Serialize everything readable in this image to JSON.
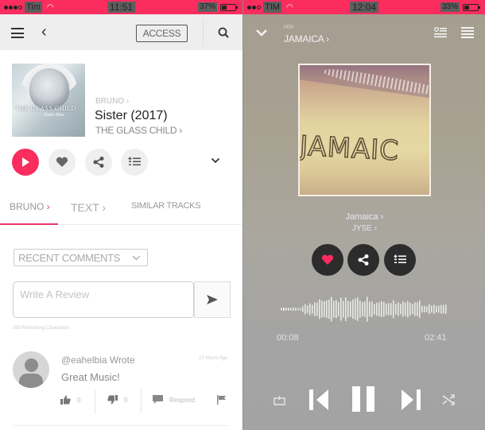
{
  "left_screen": {
    "status_bar": {
      "carrier": "Tim",
      "time": "11:51",
      "battery": "37%"
    },
    "header": {
      "access_label": "ACCESS"
    },
    "track": {
      "cover_text_1": "THE GLASS CHILD",
      "cover_text_2": "Sister Now",
      "artist": "BRUNO",
      "title": "Sister (2017)",
      "album": "THE GLASS CHILD"
    },
    "tabs": [
      {
        "label": "BRUNO",
        "active": true
      },
      {
        "label": "TEXT",
        "active": false
      },
      {
        "label": "SIMILAR TRACKS",
        "active": false
      }
    ],
    "sort_select": {
      "selected": "RECENT COMMENTS"
    },
    "review": {
      "placeholder": "Write A Review",
      "remaining": "250 Remaining Characters"
    },
    "comment": {
      "user": "@eahelbia Wrote",
      "time": "10 Hours Ago",
      "text": "Great Music!",
      "likes": "0",
      "dislikes": "0",
      "respond_label": "Respond"
    },
    "accent_color": "#fb2d5e"
  },
  "right_screen": {
    "status_bar": {
      "carrier": "TIM",
      "time": "12:04",
      "battery": "33%"
    },
    "header": {
      "context_label": "PER",
      "title": "JAMAICA"
    },
    "cover_word": "JAMAIC",
    "now_playing": {
      "track": "Jamaica",
      "artist": "JYSE"
    },
    "progress": {
      "elapsed": "00:08",
      "total": "02:41",
      "fraction": 0.05
    },
    "heart_color": "#fb2d5e"
  }
}
